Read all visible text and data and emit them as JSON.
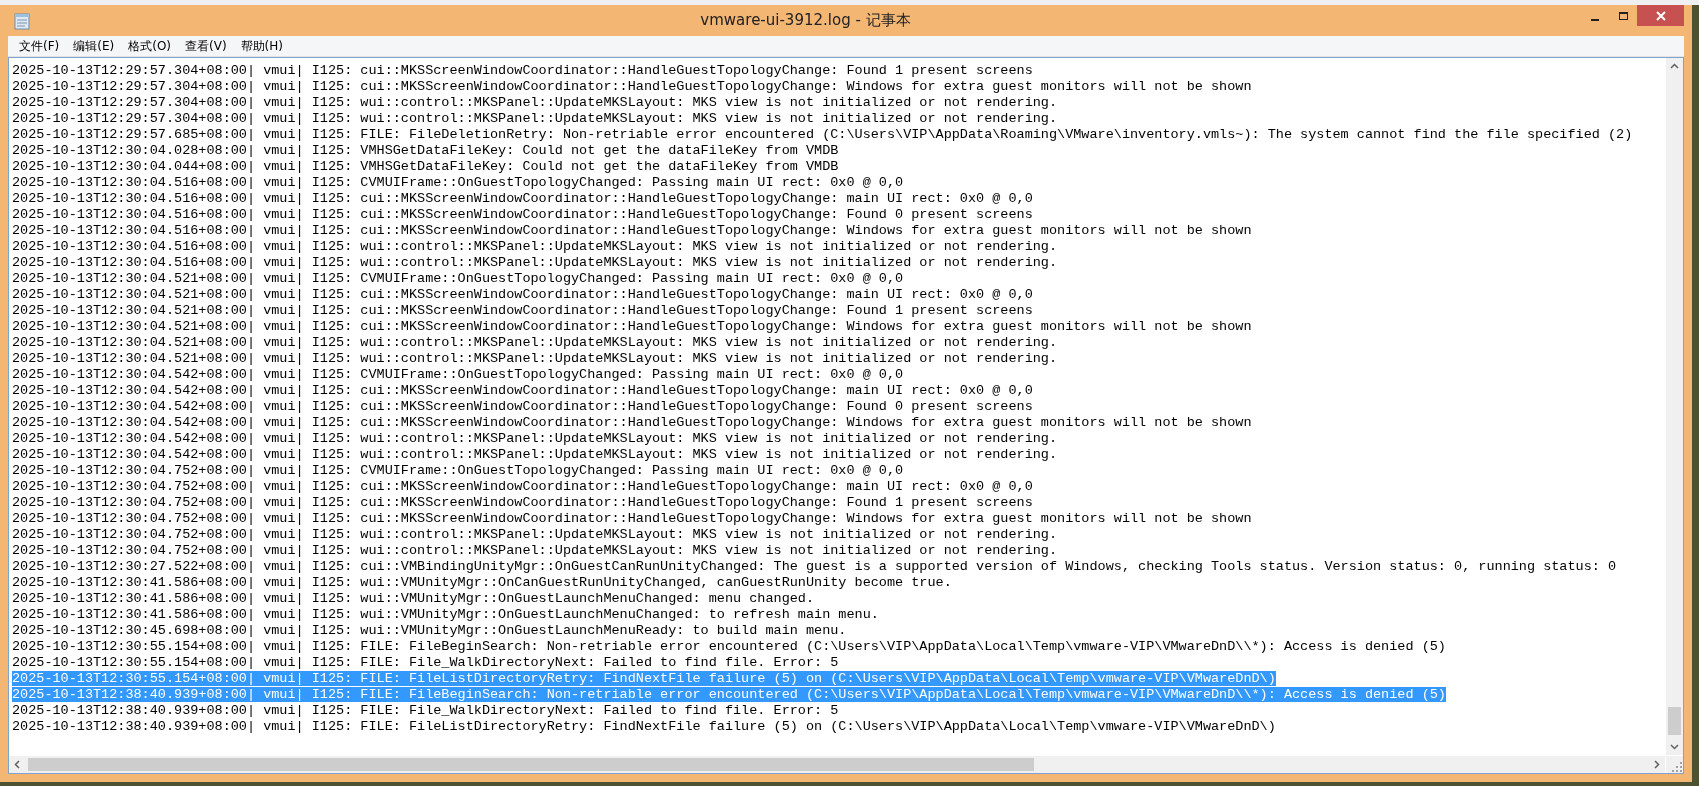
{
  "window": {
    "title": "vmware-ui-3912.log - 记事本"
  },
  "menu": [
    "文件(F)",
    "编辑(E)",
    "格式(O)",
    "查看(V)",
    "帮助(H)"
  ],
  "lines": [
    {
      "text": "2025-10-13T12:29:57.304+08:00| vmui| I125: cui::MKSScreenWindowCoordinator::HandleGuestTopologyChange: Found 1 present screens",
      "selected": false
    },
    {
      "text": "2025-10-13T12:29:57.304+08:00| vmui| I125: cui::MKSScreenWindowCoordinator::HandleGuestTopologyChange: Windows for extra guest monitors will not be shown",
      "selected": false
    },
    {
      "text": "2025-10-13T12:29:57.304+08:00| vmui| I125: wui::control::MKSPanel::UpdateMKSLayout: MKS view is not initialized or not rendering.",
      "selected": false
    },
    {
      "text": "2025-10-13T12:29:57.304+08:00| vmui| I125: wui::control::MKSPanel::UpdateMKSLayout: MKS view is not initialized or not rendering.",
      "selected": false
    },
    {
      "text": "2025-10-13T12:29:57.685+08:00| vmui| I125: FILE: FileDeletionRetry: Non-retriable error encountered (C:\\Users\\VIP\\AppData\\Roaming\\VMware\\inventory.vmls~): The system cannot find the file specified (2)",
      "selected": false
    },
    {
      "text": "2025-10-13T12:30:04.028+08:00| vmui| I125: VMHSGetDataFileKey: Could not get the dataFileKey from VMDB",
      "selected": false
    },
    {
      "text": "2025-10-13T12:30:04.044+08:00| vmui| I125: VMHSGetDataFileKey: Could not get the dataFileKey from VMDB",
      "selected": false
    },
    {
      "text": "2025-10-13T12:30:04.516+08:00| vmui| I125: CVMUIFrame::OnGuestTopologyChanged: Passing main UI rect: 0x0 @ 0,0",
      "selected": false
    },
    {
      "text": "2025-10-13T12:30:04.516+08:00| vmui| I125: cui::MKSScreenWindowCoordinator::HandleGuestTopologyChange: main UI rect: 0x0 @ 0,0",
      "selected": false
    },
    {
      "text": "2025-10-13T12:30:04.516+08:00| vmui| I125: cui::MKSScreenWindowCoordinator::HandleGuestTopologyChange: Found 0 present screens",
      "selected": false
    },
    {
      "text": "2025-10-13T12:30:04.516+08:00| vmui| I125: cui::MKSScreenWindowCoordinator::HandleGuestTopologyChange: Windows for extra guest monitors will not be shown",
      "selected": false
    },
    {
      "text": "2025-10-13T12:30:04.516+08:00| vmui| I125: wui::control::MKSPanel::UpdateMKSLayout: MKS view is not initialized or not rendering.",
      "selected": false
    },
    {
      "text": "2025-10-13T12:30:04.516+08:00| vmui| I125: wui::control::MKSPanel::UpdateMKSLayout: MKS view is not initialized or not rendering.",
      "selected": false
    },
    {
      "text": "2025-10-13T12:30:04.521+08:00| vmui| I125: CVMUIFrame::OnGuestTopologyChanged: Passing main UI rect: 0x0 @ 0,0",
      "selected": false
    },
    {
      "text": "2025-10-13T12:30:04.521+08:00| vmui| I125: cui::MKSScreenWindowCoordinator::HandleGuestTopologyChange: main UI rect: 0x0 @ 0,0",
      "selected": false
    },
    {
      "text": "2025-10-13T12:30:04.521+08:00| vmui| I125: cui::MKSScreenWindowCoordinator::HandleGuestTopologyChange: Found 1 present screens",
      "selected": false
    },
    {
      "text": "2025-10-13T12:30:04.521+08:00| vmui| I125: cui::MKSScreenWindowCoordinator::HandleGuestTopologyChange: Windows for extra guest monitors will not be shown",
      "selected": false
    },
    {
      "text": "2025-10-13T12:30:04.521+08:00| vmui| I125: wui::control::MKSPanel::UpdateMKSLayout: MKS view is not initialized or not rendering.",
      "selected": false
    },
    {
      "text": "2025-10-13T12:30:04.521+08:00| vmui| I125: wui::control::MKSPanel::UpdateMKSLayout: MKS view is not initialized or not rendering.",
      "selected": false
    },
    {
      "text": "2025-10-13T12:30:04.542+08:00| vmui| I125: CVMUIFrame::OnGuestTopologyChanged: Passing main UI rect: 0x0 @ 0,0",
      "selected": false
    },
    {
      "text": "2025-10-13T12:30:04.542+08:00| vmui| I125: cui::MKSScreenWindowCoordinator::HandleGuestTopologyChange: main UI rect: 0x0 @ 0,0",
      "selected": false
    },
    {
      "text": "2025-10-13T12:30:04.542+08:00| vmui| I125: cui::MKSScreenWindowCoordinator::HandleGuestTopologyChange: Found 0 present screens",
      "selected": false
    },
    {
      "text": "2025-10-13T12:30:04.542+08:00| vmui| I125: cui::MKSScreenWindowCoordinator::HandleGuestTopologyChange: Windows for extra guest monitors will not be shown",
      "selected": false
    },
    {
      "text": "2025-10-13T12:30:04.542+08:00| vmui| I125: wui::control::MKSPanel::UpdateMKSLayout: MKS view is not initialized or not rendering.",
      "selected": false
    },
    {
      "text": "2025-10-13T12:30:04.542+08:00| vmui| I125: wui::control::MKSPanel::UpdateMKSLayout: MKS view is not initialized or not rendering.",
      "selected": false
    },
    {
      "text": "2025-10-13T12:30:04.752+08:00| vmui| I125: CVMUIFrame::OnGuestTopologyChanged: Passing main UI rect: 0x0 @ 0,0",
      "selected": false
    },
    {
      "text": "2025-10-13T12:30:04.752+08:00| vmui| I125: cui::MKSScreenWindowCoordinator::HandleGuestTopologyChange: main UI rect: 0x0 @ 0,0",
      "selected": false
    },
    {
      "text": "2025-10-13T12:30:04.752+08:00| vmui| I125: cui::MKSScreenWindowCoordinator::HandleGuestTopologyChange: Found 1 present screens",
      "selected": false
    },
    {
      "text": "2025-10-13T12:30:04.752+08:00| vmui| I125: cui::MKSScreenWindowCoordinator::HandleGuestTopologyChange: Windows for extra guest monitors will not be shown",
      "selected": false
    },
    {
      "text": "2025-10-13T12:30:04.752+08:00| vmui| I125: wui::control::MKSPanel::UpdateMKSLayout: MKS view is not initialized or not rendering.",
      "selected": false
    },
    {
      "text": "2025-10-13T12:30:04.752+08:00| vmui| I125: wui::control::MKSPanel::UpdateMKSLayout: MKS view is not initialized or not rendering.",
      "selected": false
    },
    {
      "text": "2025-10-13T12:30:27.522+08:00| vmui| I125: cui::VMBindingUnityMgr::OnGuestCanRunUnityChanged: The guest is a supported version of Windows, checking Tools status. Version status: 0, running status: 0",
      "selected": false
    },
    {
      "text": "2025-10-13T12:30:41.586+08:00| vmui| I125: wui::VMUnityMgr::OnCanGuestRunUnityChanged, canGuestRunUnity become true.",
      "selected": false
    },
    {
      "text": "2025-10-13T12:30:41.586+08:00| vmui| I125: wui::VMUnityMgr::OnGuestLaunchMenuChanged: menu changed.",
      "selected": false
    },
    {
      "text": "2025-10-13T12:30:41.586+08:00| vmui| I125: wui::VMUnityMgr::OnGuestLaunchMenuChanged: to refresh main menu.",
      "selected": false
    },
    {
      "text": "2025-10-13T12:30:45.698+08:00| vmui| I125: wui::VMUnityMgr::OnGuestLaunchMenuReady: to build main menu.",
      "selected": false
    },
    {
      "text": "2025-10-13T12:30:55.154+08:00| vmui| I125: FILE: FileBeginSearch: Non-retriable error encountered (C:\\Users\\VIP\\AppData\\Local\\Temp\\vmware-VIP\\VMwareDnD\\\\*): Access is denied (5)",
      "selected": false
    },
    {
      "text": "2025-10-13T12:30:55.154+08:00| vmui| I125: FILE: File_WalkDirectoryNext: Failed to find file. Error: 5",
      "selected": false
    },
    {
      "text": "2025-10-13T12:30:55.154+08:00| vmui| I125: FILE: FileListDirectoryRetry: FindNextFile failure (5) on (C:\\Users\\VIP\\AppData\\Local\\Temp\\vmware-VIP\\VMwareDnD\\)",
      "selected": true
    },
    {
      "text": "2025-10-13T12:38:40.939+08:00| vmui| I125: FILE: FileBeginSearch: Non-retriable error encountered (C:\\Users\\VIP\\AppData\\Local\\Temp\\vmware-VIP\\VMwareDnD\\\\*): Access is denied (5)",
      "selected": true
    },
    {
      "text": "2025-10-13T12:38:40.939+08:00| vmui| I125: FILE: File_WalkDirectoryNext: Failed to find file. Error: 5",
      "selected": false
    },
    {
      "text": "2025-10-13T12:38:40.939+08:00| vmui| I125: FILE: FileListDirectoryRetry: FindNextFile failure (5) on (C:\\Users\\VIP\\AppData\\Local\\Temp\\vmware-VIP\\VMwareDnD\\)",
      "selected": false
    }
  ]
}
